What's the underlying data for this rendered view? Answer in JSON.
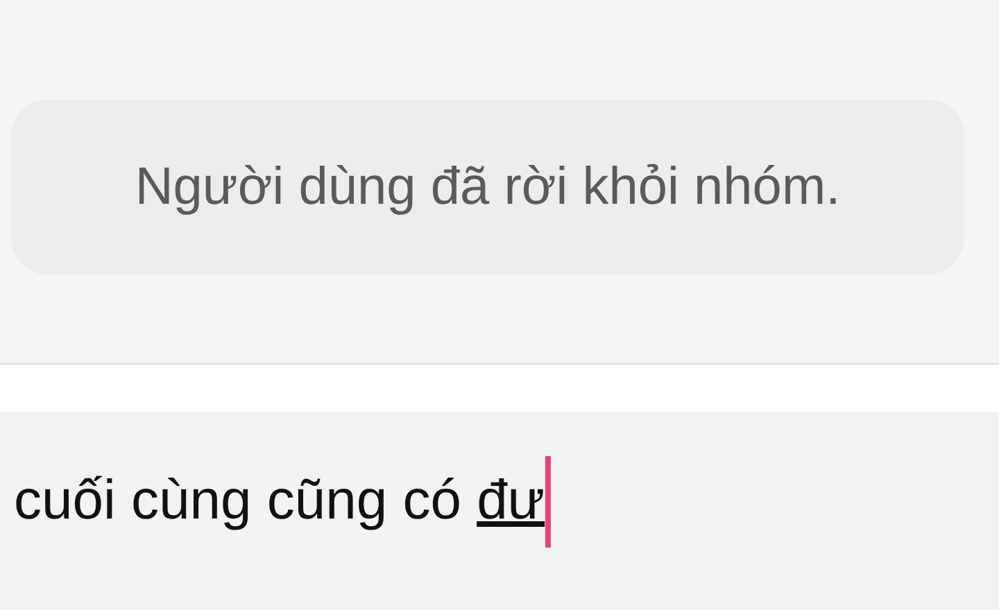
{
  "system_message": {
    "text": "Người dùng đã rời khỏi nhóm."
  },
  "composer": {
    "committed_text": "cuối cùng cũng có ",
    "composing_text": "đư"
  }
}
